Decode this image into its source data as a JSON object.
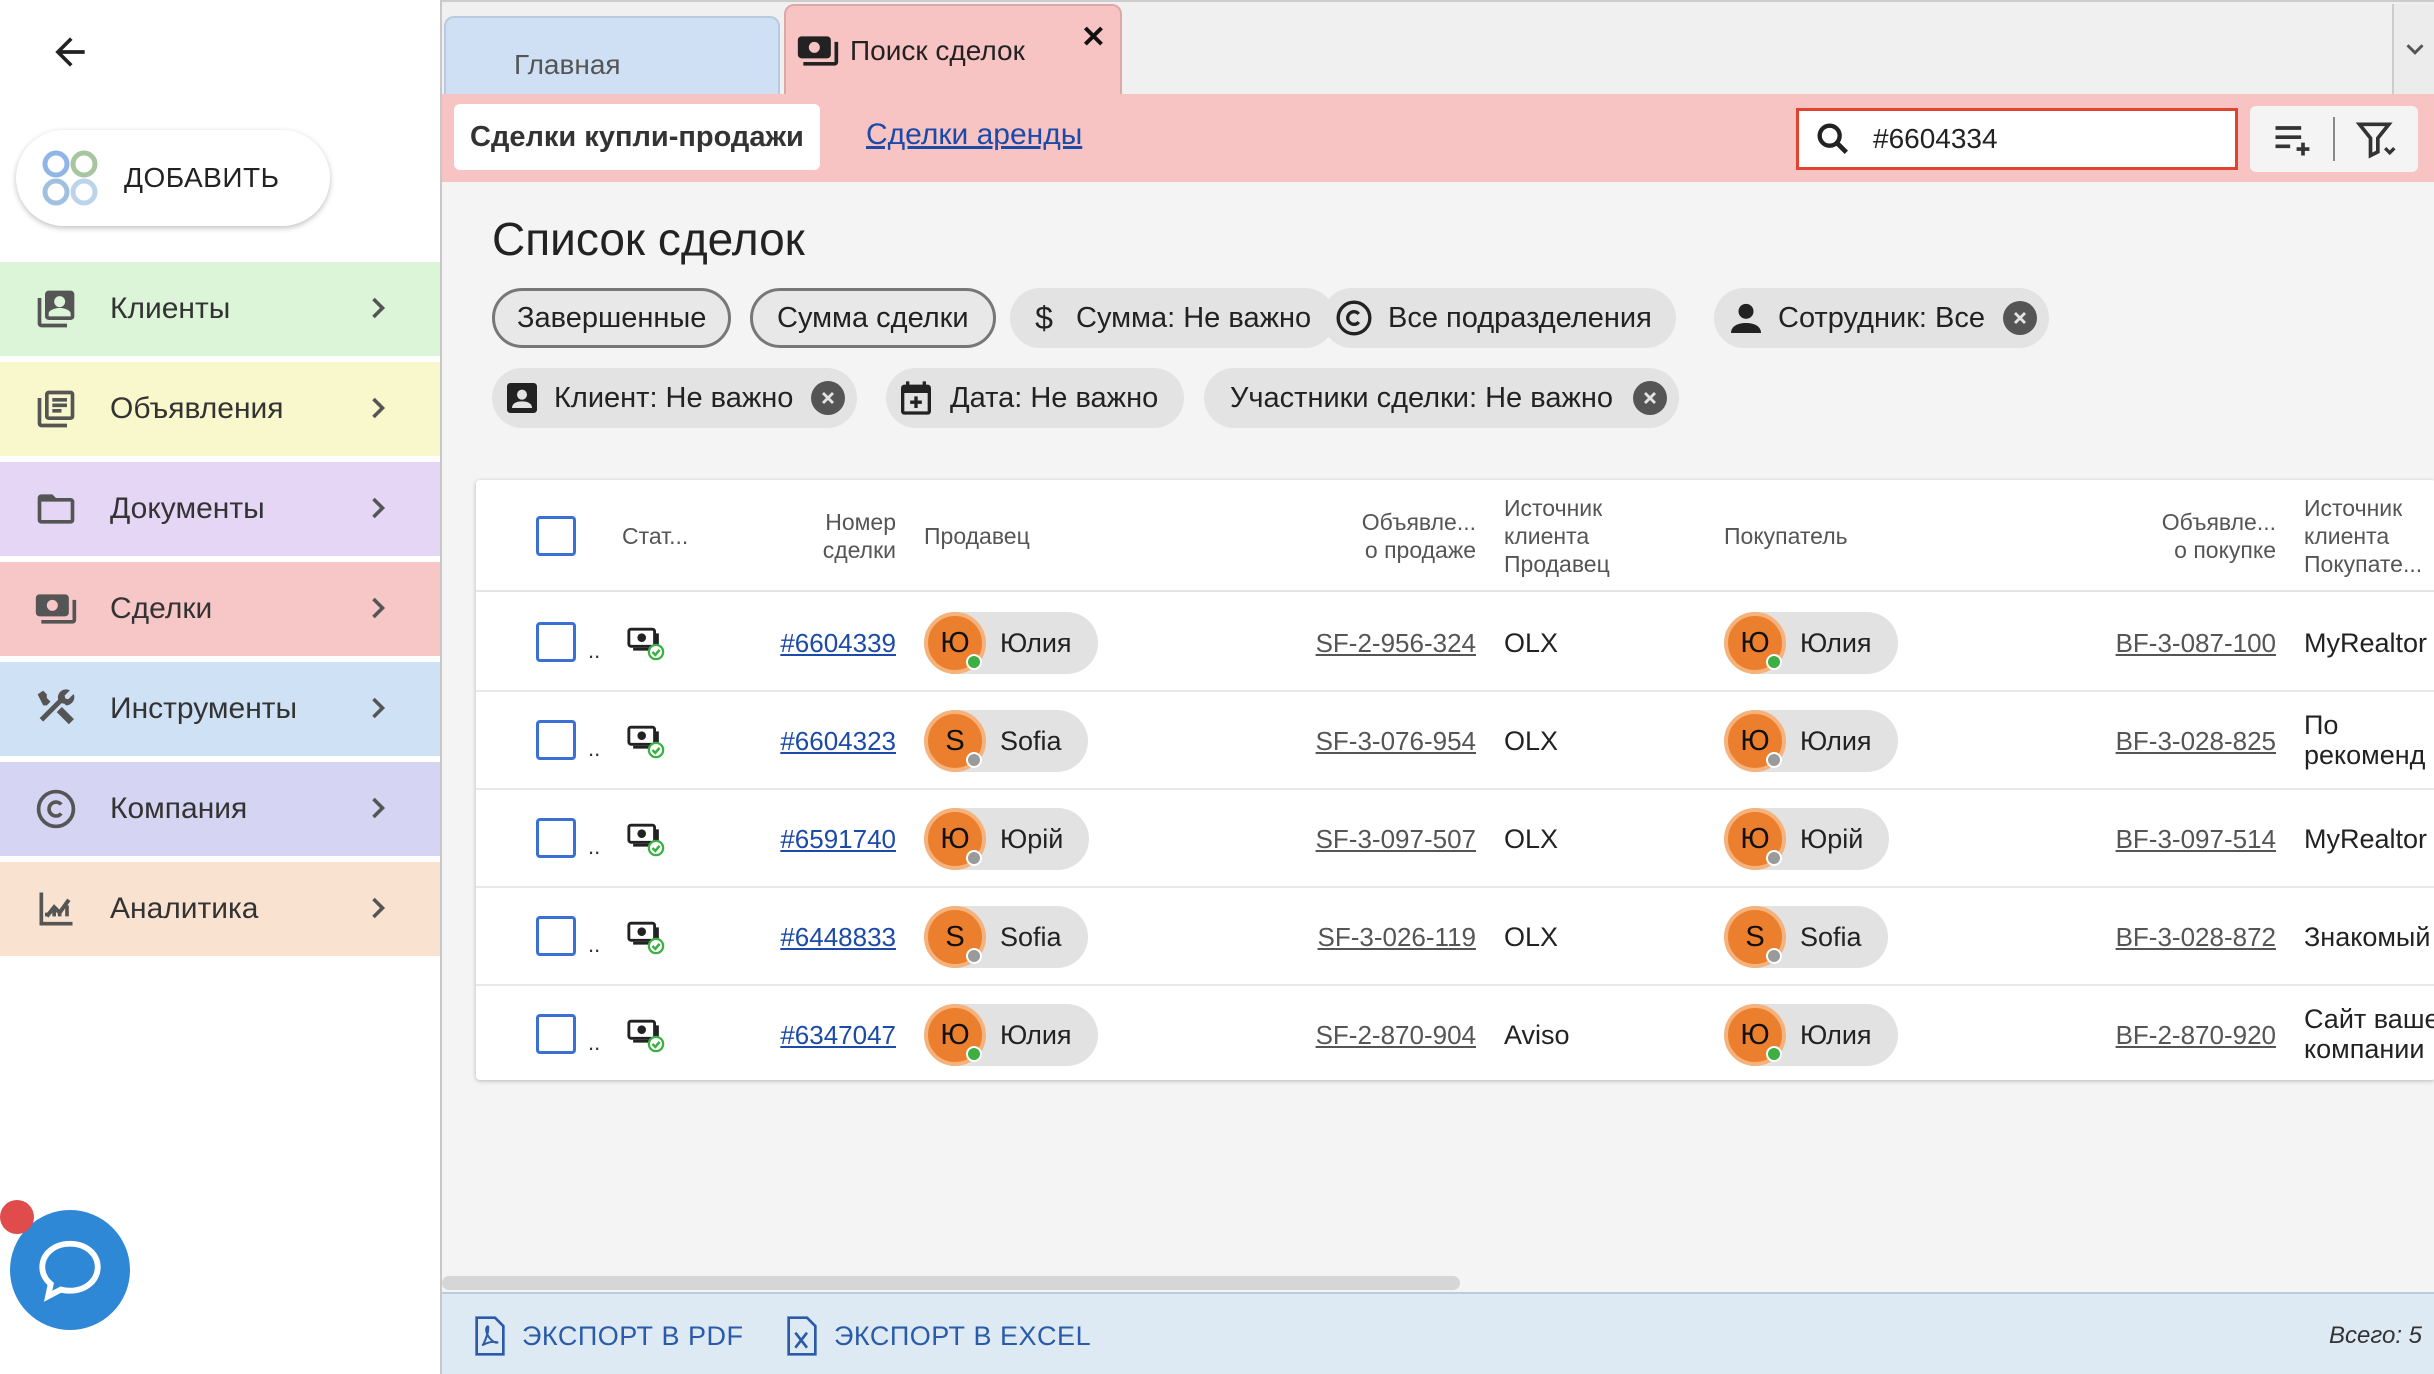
{
  "sidebar": {
    "add_label": "ДОБАВИТЬ",
    "items": [
      {
        "label": "Клиенты",
        "bg": "#dcf5d8"
      },
      {
        "label": "Объявления",
        "bg": "#f9f8cd"
      },
      {
        "label": "Документы",
        "bg": "#e6d6f6"
      },
      {
        "label": "Сделки",
        "bg": "#f7c6c6"
      },
      {
        "label": "Инструменты",
        "bg": "#cfe1f5"
      },
      {
        "label": "Компания",
        "bg": "#d6d4f3"
      },
      {
        "label": "Аналитика",
        "bg": "#f9e3d0"
      }
    ]
  },
  "tabs": {
    "home": "Главная",
    "search": "Поиск сделок",
    "close": "✕"
  },
  "subtabs": {
    "active": "Сделки купли-продажи",
    "rent": "Сделки аренды"
  },
  "search": {
    "value": "#6604334"
  },
  "page_title": "Список сделок",
  "filters": {
    "completed": "Завершенные",
    "sum_deal": "Сумма сделки",
    "amount": "Сумма: Не важно",
    "divisions": "Все подразделения",
    "employee": "Сотрудник: Все",
    "client": "Клиент: Не важно",
    "date": "Дата: Не важно",
    "participants": "Участники сделки: Не важно"
  },
  "table": {
    "headers": {
      "status": "Стат...",
      "number_1": "Номер",
      "number_2": "сделки",
      "seller": "Продавец",
      "sale_ad_1": "Объявле...",
      "sale_ad_2": "о продаже",
      "seller_src_1": "Источник",
      "seller_src_2": "клиента",
      "seller_src_3": "Продавец",
      "buyer": "Покупатель",
      "buy_ad_1": "Объявле...",
      "buy_ad_2": "о покупке",
      "buyer_src_1": "Источник",
      "buyer_src_2": "клиента",
      "buyer_src_3": "Покупате..."
    },
    "rows": [
      {
        "dots": "..",
        "number": "#6604339",
        "seller_initial": "Ю",
        "seller": "Юлия",
        "seller_online": true,
        "sale_ad": "SF-2-956-324",
        "seller_src": "OLX",
        "buyer_initial": "Ю",
        "buyer": "Юлия",
        "buyer_online": true,
        "buy_ad": "BF-3-087-100",
        "buyer_src_1": "MyRealtor",
        "buyer_src_2": ""
      },
      {
        "dots": "..",
        "number": "#6604323",
        "seller_initial": "S",
        "seller": "Sofia",
        "seller_online": false,
        "sale_ad": "SF-3-076-954",
        "seller_src": "OLX",
        "buyer_initial": "Ю",
        "buyer": "Юлия",
        "buyer_online": false,
        "buy_ad": "BF-3-028-825",
        "buyer_src_1": "По",
        "buyer_src_2": "рекоменд"
      },
      {
        "dots": "..",
        "number": "#6591740",
        "seller_initial": "Ю",
        "seller": "Юрій",
        "seller_online": false,
        "sale_ad": "SF-3-097-507",
        "seller_src": "OLX",
        "buyer_initial": "Ю",
        "buyer": "Юрій",
        "buyer_online": false,
        "buy_ad": "BF-3-097-514",
        "buyer_src_1": "MyRealtor",
        "buyer_src_2": ""
      },
      {
        "dots": "..",
        "number": "#6448833",
        "seller_initial": "S",
        "seller": "Sofia",
        "seller_online": false,
        "sale_ad": "SF-3-026-119",
        "seller_src": "OLX",
        "buyer_initial": "S",
        "buyer": "Sofia",
        "buyer_online": false,
        "buy_ad": "BF-3-028-872",
        "buyer_src_1": "Знакомый",
        "buyer_src_2": ""
      },
      {
        "dots": "..",
        "number": "#6347047",
        "seller_initial": "Ю",
        "seller": "Юлия",
        "seller_online": true,
        "sale_ad": "SF-2-870-904",
        "seller_src": "Aviso",
        "buyer_initial": "Ю",
        "buyer": "Юлия",
        "buyer_online": true,
        "buy_ad": "BF-2-870-920",
        "buyer_src_1": "Сайт ваше",
        "buyer_src_2": "компании"
      }
    ]
  },
  "footer": {
    "export_pdf": "ЭКСПОРТ В PDF",
    "export_excel": "ЭКСПОРТ В EXCEL",
    "total": "Всего: 5"
  },
  "colors": {
    "accent_link": "#1b4aa8",
    "tab_active": "#f7c3c3",
    "search_border": "#e0432f",
    "online": "#3cb043",
    "offline": "#9a9a9a"
  }
}
